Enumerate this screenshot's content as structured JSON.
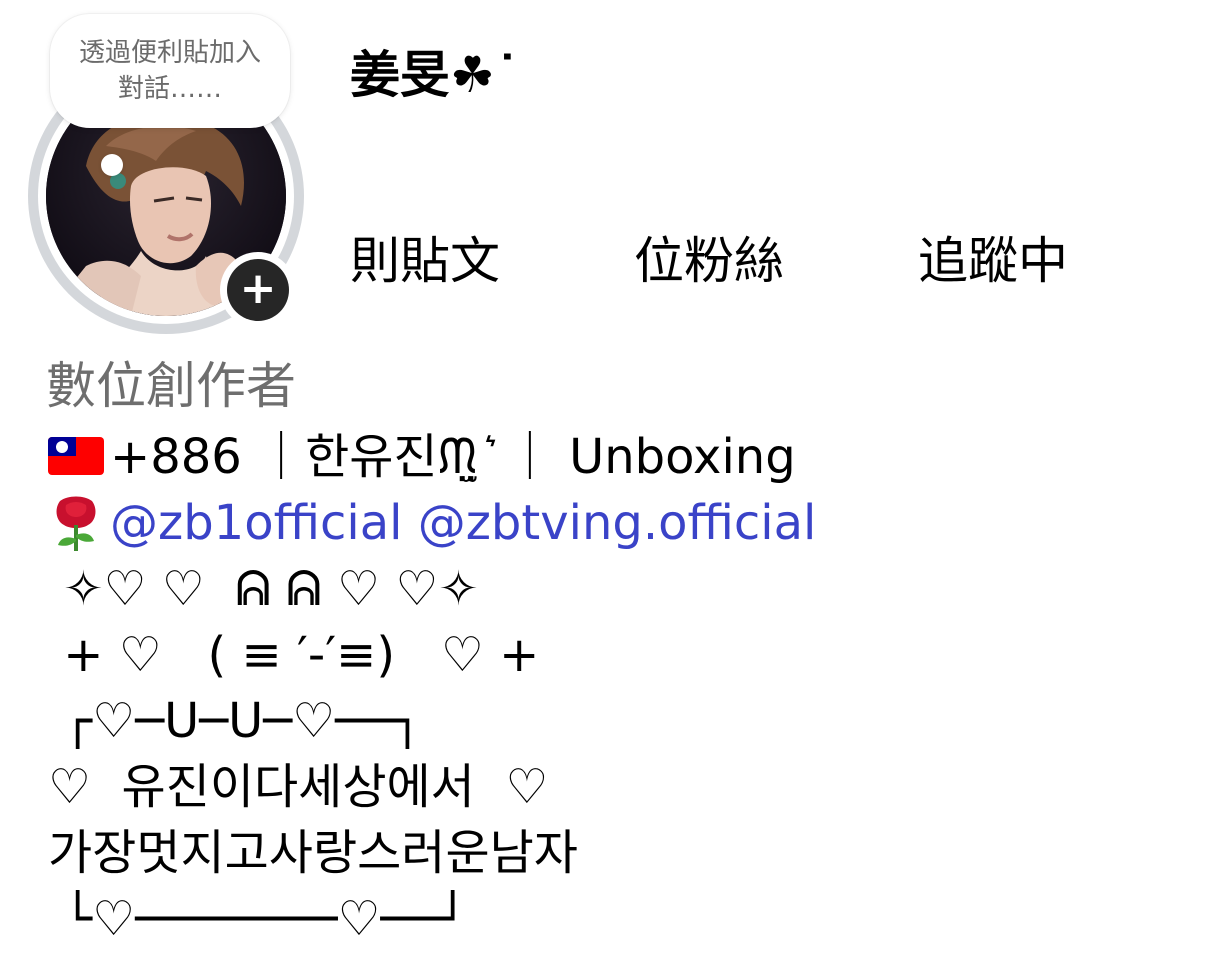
{
  "note": {
    "text": "透過便利貼加入對話……"
  },
  "profile": {
    "username": "姜旻☘︎˙",
    "add_story_symbol": "+"
  },
  "stats": {
    "posts": {
      "value": "",
      "label": "則貼文"
    },
    "followers": {
      "value": "",
      "label": "位粉絲"
    },
    "following": {
      "value": "",
      "label": "追蹤中"
    }
  },
  "category": "數位創作者",
  "bio": {
    "line1": "+886 ｜한유진ᙏ̤̫ ͛ ｜ Unboxing",
    "mention1": "@zb1official",
    "mention2": "@zbtving.official",
    "line3": " ✧♡ ♡  ᕱ ᕱ ♡ ♡✧",
    "line4": " + ♡   ( ≡ ′-′≡)   ♡ +",
    "line5": " ┌♡─U─U─♡──┐",
    "line6": "♡  유진이다세상에서  ♡",
    "line7": "가장멋지고사랑스러운남자",
    "line8": " └♡───────♡──┘"
  },
  "colors": {
    "mention": "#3a43c8",
    "category": "#6e6e6e",
    "ring": "#d4d7db"
  },
  "icons": {
    "flag": "taiwan-flag-icon",
    "rose": "rose-icon",
    "add": "plus-icon"
  }
}
